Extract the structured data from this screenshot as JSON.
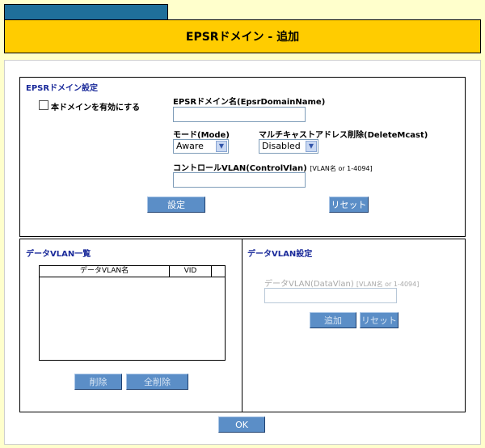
{
  "title": "EPSRドメイン - 追加",
  "domain_settings": {
    "section_title": "EPSRドメイン設定",
    "enable_label": "本ドメインを有効にする",
    "domain_name_label": "EPSRドメイン名(EpsrDomainName)",
    "domain_name_value": "",
    "mode_label": "モード(Mode)",
    "mode_value": "Aware",
    "delete_mcast_label": "マルチキャストアドレス削除(DeleteMcast)",
    "delete_mcast_value": "Disabled",
    "control_vlan_label": "コントロールVLAN(ControlVlan)",
    "control_vlan_hint": "[VLAN名 or 1-4094]",
    "control_vlan_value": "",
    "set_button": "設定",
    "reset_button": "リセット"
  },
  "data_vlan_list": {
    "section_title": "データVLAN一覧",
    "columns": [
      "データVLAN名",
      "VID"
    ],
    "rows": [],
    "delete_button": "削除",
    "delete_all_button": "全削除"
  },
  "data_vlan_settings": {
    "section_title": "データVLAN設定",
    "label": "データVLAN(DataVlan)",
    "hint": "[VLAN名 or 1-4094]",
    "value": "",
    "add_button": "追加",
    "reset_button": "リセット"
  },
  "ok_button": "OK",
  "colors": {
    "background": "#ffffcc",
    "title_bar": "#ffcc00",
    "tab": "#1f6f9a",
    "button": "#5b8ec7",
    "section_title": "#1a2a9a"
  }
}
